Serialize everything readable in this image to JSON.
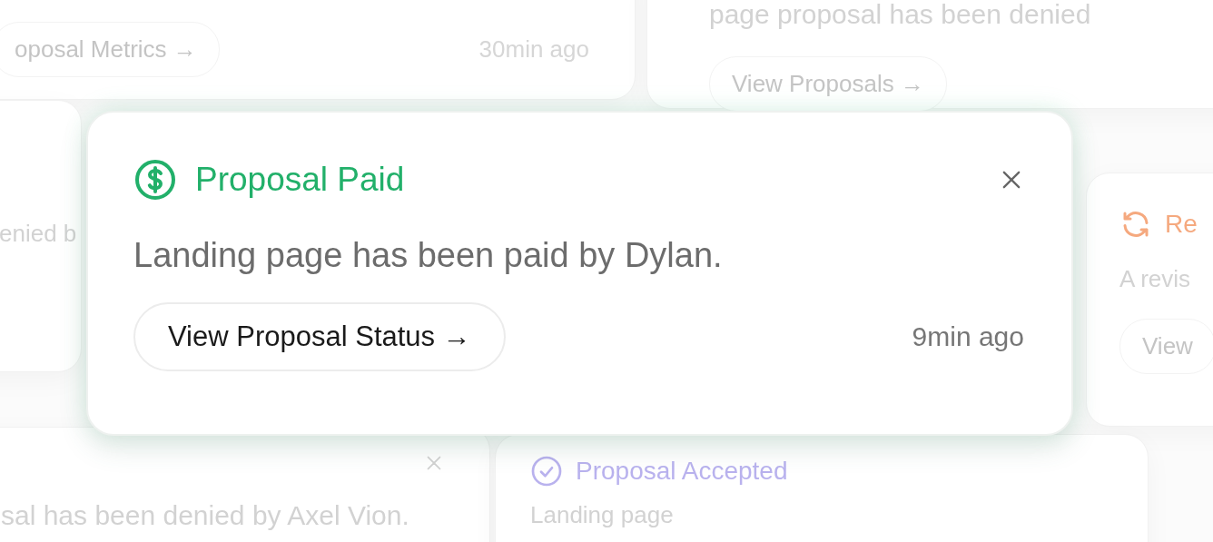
{
  "background_cards": [
    {
      "kind": "plain",
      "button": "oposal Metrics →",
      "time": "30min ago"
    },
    {
      "kind": "plain",
      "message": "page proposal has been denied",
      "button": "View Proposals →"
    },
    {
      "kind": "plain",
      "message": "enied b"
    },
    {
      "kind": "revision",
      "title": "Re",
      "color": "#f5a97f",
      "message": "A revis",
      "button": "View"
    },
    {
      "kind": "closable",
      "message": "sal has been denied by Axel Vion."
    },
    {
      "kind": "accepted",
      "title": "Proposal Accepted",
      "color": "#b9b2ee",
      "message": "Landing page"
    }
  ],
  "notification": {
    "kind": "paid",
    "title": "Proposal Paid",
    "color": "#22b06a",
    "message": "Landing page has been paid by Dylan.",
    "button": "View Proposal Status →",
    "time": "9min ago",
    "closable": true
  }
}
